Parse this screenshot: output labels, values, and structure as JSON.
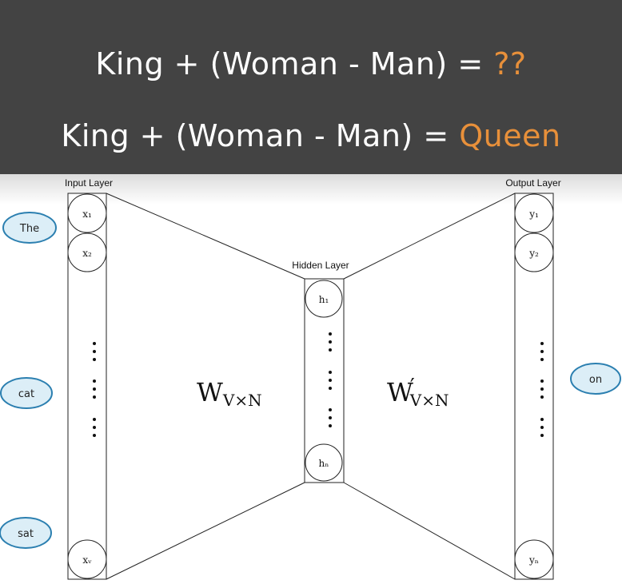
{
  "header": {
    "line1": {
      "prefix": "King + (Woman - Man) = ",
      "answer": "??"
    },
    "line2": {
      "prefix": "King + (Woman - Man) = ",
      "answer": "Queen"
    },
    "accent_color": "#e8903a",
    "background_color": "#434343"
  },
  "diagram": {
    "input_layer_label": "Input Layer",
    "hidden_layer_label": "Hidden Layer",
    "output_layer_label": "Output Layer",
    "input_nodes": {
      "first": "x₁",
      "second": "x₂",
      "last": "xᵥ"
    },
    "hidden_nodes": {
      "first": "h₁",
      "last": "hₙ"
    },
    "output_nodes": {
      "first": "y₁",
      "second": "y₂",
      "last": "yₙ"
    },
    "weight_in": {
      "base": "W",
      "sub": "V×N"
    },
    "weight_out": {
      "base": "W",
      "prime": "′",
      "sub": "V×N"
    },
    "context_words": [
      "The",
      "cat",
      "sat"
    ],
    "target_word": "on",
    "word_bubble_fill": "#dceef7",
    "word_bubble_stroke": "#2b7fb0"
  }
}
